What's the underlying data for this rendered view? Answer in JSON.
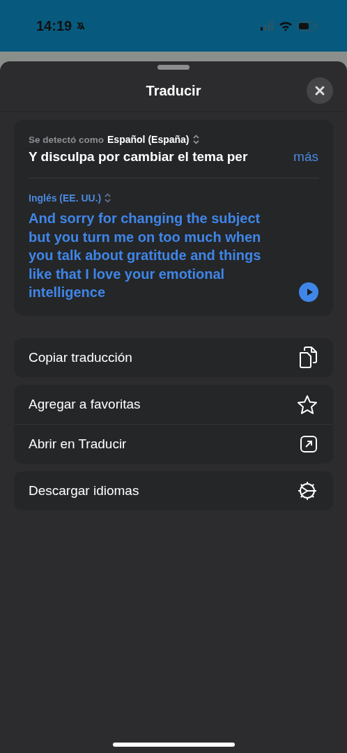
{
  "status_bar": {
    "time": "14:19"
  },
  "sheet": {
    "title": "Traducir"
  },
  "source": {
    "detected_label": "Se detectó como",
    "language": "Español (España)",
    "text": "Y disculpa por cambiar el tema per",
    "more": "más"
  },
  "target": {
    "language": "Inglés (EE. UU.)",
    "text": "And sorry for changing the subject but you turn me on too much when you talk about gratitude and things like that I love your emotional intelligence"
  },
  "action_groups": [
    [
      {
        "label": "Copiar traducción",
        "kind": "copy"
      }
    ],
    [
      {
        "label": "Agregar a favoritas",
        "kind": "star"
      },
      {
        "label": "Abrir en Traducir",
        "kind": "open"
      }
    ],
    [
      {
        "label": "Descargar idiomas",
        "kind": "download"
      }
    ]
  ]
}
